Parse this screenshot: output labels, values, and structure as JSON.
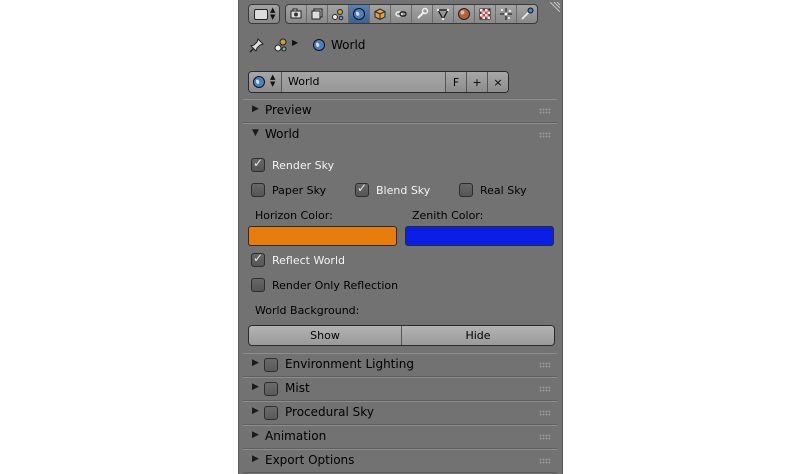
{
  "header": {
    "editor_type_icon": "properties-editor-icon",
    "context_tabs": [
      {
        "icon": "render-icon",
        "active": false
      },
      {
        "icon": "render-layers-icon",
        "active": false
      },
      {
        "icon": "scene-icon",
        "active": false
      },
      {
        "icon": "world-icon",
        "active": true
      },
      {
        "icon": "object-icon",
        "active": false
      },
      {
        "icon": "constraints-icon",
        "active": false
      },
      {
        "icon": "modifiers-icon",
        "active": false
      },
      {
        "icon": "object-data-icon",
        "active": false
      },
      {
        "icon": "material-icon",
        "active": false
      },
      {
        "icon": "texture-icon",
        "active": false
      },
      {
        "icon": "particles-icon",
        "active": false
      },
      {
        "icon": "physics-icon",
        "active": false
      }
    ]
  },
  "breadcrumb": {
    "label": "World"
  },
  "datablock": {
    "name": "World",
    "fake_user": "F",
    "add": "+",
    "remove": "×"
  },
  "panels": {
    "preview": "Preview",
    "world": "World",
    "environment_lighting": "Environment Lighting",
    "mist": "Mist",
    "procedural_sky": "Procedural Sky",
    "animation": "Animation",
    "export_options": "Export Options"
  },
  "world": {
    "render_sky": {
      "label": "Render Sky",
      "checked": true
    },
    "paper_sky": {
      "label": "Paper Sky",
      "checked": false
    },
    "blend_sky": {
      "label": "Blend Sky",
      "checked": true
    },
    "real_sky": {
      "label": "Real Sky",
      "checked": false
    },
    "horizon_label": "Horizon Color:",
    "zenith_label": "Zenith Color:",
    "horizon_color": "#e87d0d",
    "zenith_color": "#0a1ee6",
    "reflect_world": {
      "label": "Reflect World",
      "checked": true
    },
    "render_only_reflection": {
      "label": "Render Only Reflection",
      "checked": false
    },
    "background_label": "World Background:",
    "show_label": "Show",
    "hide_label": "Hide"
  }
}
